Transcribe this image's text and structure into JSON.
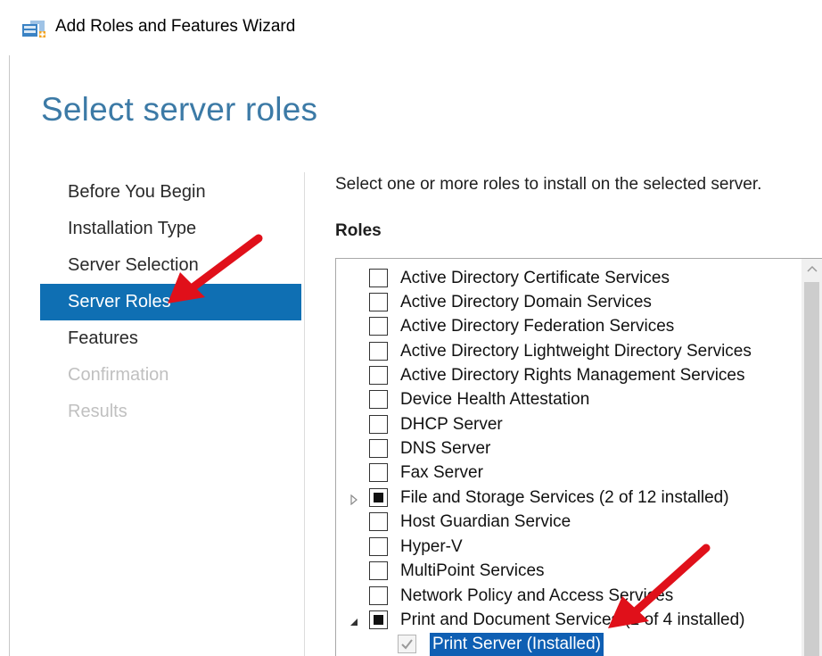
{
  "window": {
    "title": "Add Roles and Features Wizard",
    "icon": "server-manager-icon"
  },
  "page": {
    "title": "Select server roles"
  },
  "nav": {
    "items": [
      {
        "label": "Before You Begin",
        "state": "normal"
      },
      {
        "label": "Installation Type",
        "state": "normal"
      },
      {
        "label": "Server Selection",
        "state": "normal"
      },
      {
        "label": "Server Roles",
        "state": "active"
      },
      {
        "label": "Features",
        "state": "normal"
      },
      {
        "label": "Confirmation",
        "state": "disabled"
      },
      {
        "label": "Results",
        "state": "disabled"
      }
    ]
  },
  "content": {
    "instruction": "Select one or more roles to install on the selected server.",
    "roles_heading": "Roles",
    "roles": [
      {
        "label": "Active Directory Certificate Services",
        "checked": "none",
        "expander": "none"
      },
      {
        "label": "Active Directory Domain Services",
        "checked": "none",
        "expander": "none"
      },
      {
        "label": "Active Directory Federation Services",
        "checked": "none",
        "expander": "none"
      },
      {
        "label": "Active Directory Lightweight Directory Services",
        "checked": "none",
        "expander": "none"
      },
      {
        "label": "Active Directory Rights Management Services",
        "checked": "none",
        "expander": "none"
      },
      {
        "label": "Device Health Attestation",
        "checked": "none",
        "expander": "none"
      },
      {
        "label": "DHCP Server",
        "checked": "none",
        "expander": "none"
      },
      {
        "label": "DNS Server",
        "checked": "none",
        "expander": "none"
      },
      {
        "label": "Fax Server",
        "checked": "none",
        "expander": "none"
      },
      {
        "label": "File and Storage Services (2 of 12 installed)",
        "checked": "partial",
        "expander": "collapsed"
      },
      {
        "label": "Host Guardian Service",
        "checked": "none",
        "expander": "none"
      },
      {
        "label": "Hyper-V",
        "checked": "none",
        "expander": "none"
      },
      {
        "label": "MultiPoint Services",
        "checked": "none",
        "expander": "none"
      },
      {
        "label": "Network Policy and Access Services",
        "checked": "none",
        "expander": "none"
      },
      {
        "label": "Print and Document Services (1 of 4 installed)",
        "checked": "partial",
        "expander": "expanded"
      },
      {
        "label": "Print Server (Installed)",
        "checked": "checked-disabled",
        "expander": "none",
        "child": true,
        "selected": true
      }
    ]
  },
  "colors": {
    "accent": "#0f6fb3",
    "title": "#3c7aa6",
    "arrow": "#e0101a"
  }
}
